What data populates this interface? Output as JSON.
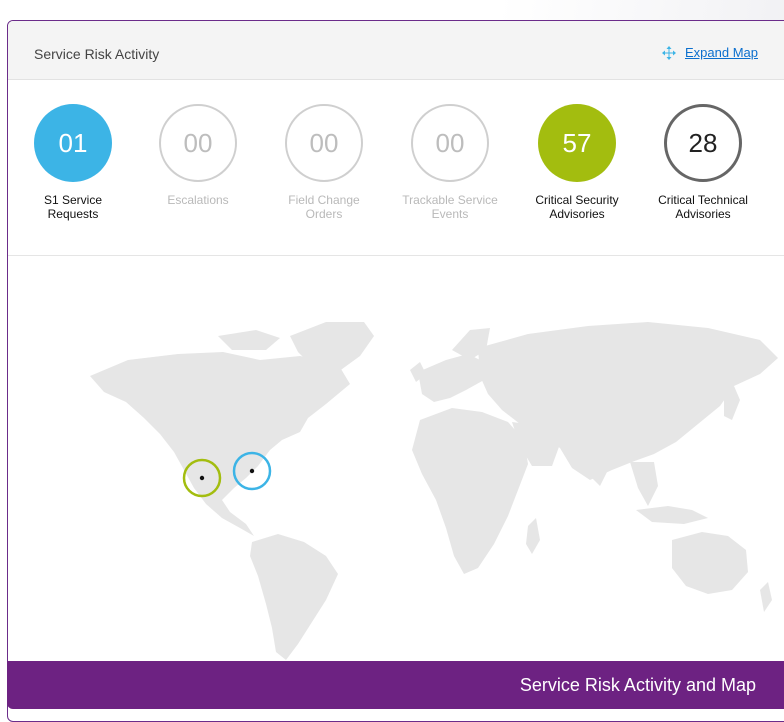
{
  "panel": {
    "title": "Service Risk Activity",
    "expand_label": "Expand Map"
  },
  "stats": [
    {
      "value": "01",
      "label_line1": "S1 Service",
      "label_line2": "Requests",
      "style": "blue"
    },
    {
      "value": "00",
      "label_line1": "Escalations",
      "label_line2": "",
      "style": "gray"
    },
    {
      "value": "00",
      "label_line1": "Field Change",
      "label_line2": "Orders",
      "style": "gray"
    },
    {
      "value": "00",
      "label_line1": "Trackable Service",
      "label_line2": "Events",
      "style": "gray"
    },
    {
      "value": "57",
      "label_line1": "Critical Security",
      "label_line2": "Advisories",
      "style": "green"
    },
    {
      "value": "28",
      "label_line1": "Critical Technical",
      "label_line2": "Advisories",
      "style": "dark"
    }
  ],
  "map": {
    "markers": [
      {
        "name": "southwest-us-marker",
        "color": "#a3bd0f"
      },
      {
        "name": "eastern-us-marker",
        "color": "#3cb4e6"
      }
    ]
  },
  "caption": "Service Risk Activity and Map",
  "colors": {
    "accent_blue": "#3cb4e6",
    "accent_green": "#a3bd0f",
    "brand_purple": "#6d2282",
    "link_blue": "#0b6fce"
  }
}
